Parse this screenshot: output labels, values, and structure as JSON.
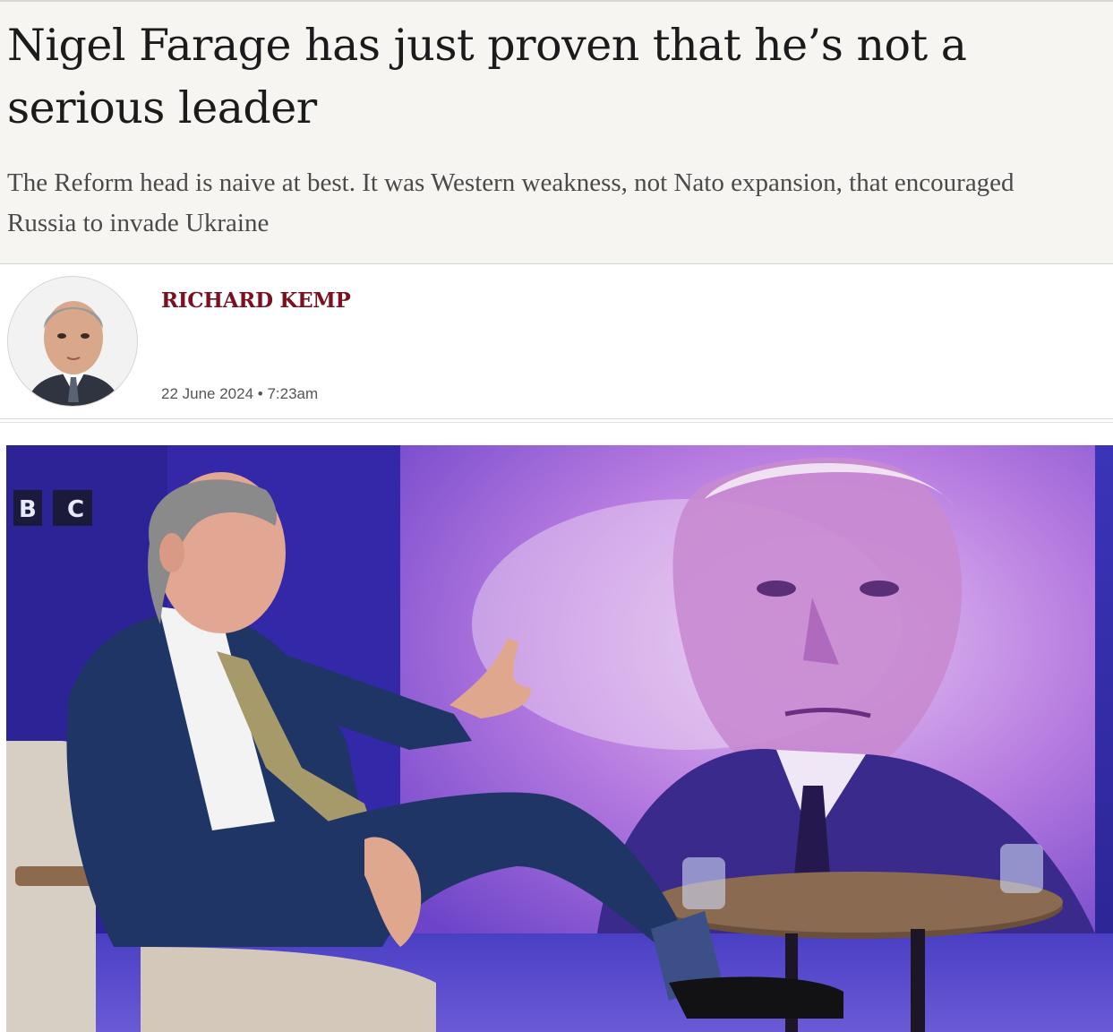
{
  "article": {
    "headline": "Nigel Farage has just proven that he’s not a serious leader",
    "standfirst": "The Reform head is naive at best. It was Western weakness, not Nato expansion, that encouraged Russia to invade Ukraine"
  },
  "byline": {
    "author": "RICHARD KEMP",
    "date": "22 June 2024",
    "separator": "•",
    "time": "7:23am"
  },
  "photo": {
    "studio_letters": [
      "B",
      "C"
    ]
  },
  "colors": {
    "author": "#7a1020",
    "header_bg": "#f7f5f1",
    "studio_blue": "#3a2fb0",
    "screen_purple": "#a15fd6"
  },
  "icons": {
    "author_avatar": "author-portrait",
    "studio_logo": "bbc-logo"
  }
}
